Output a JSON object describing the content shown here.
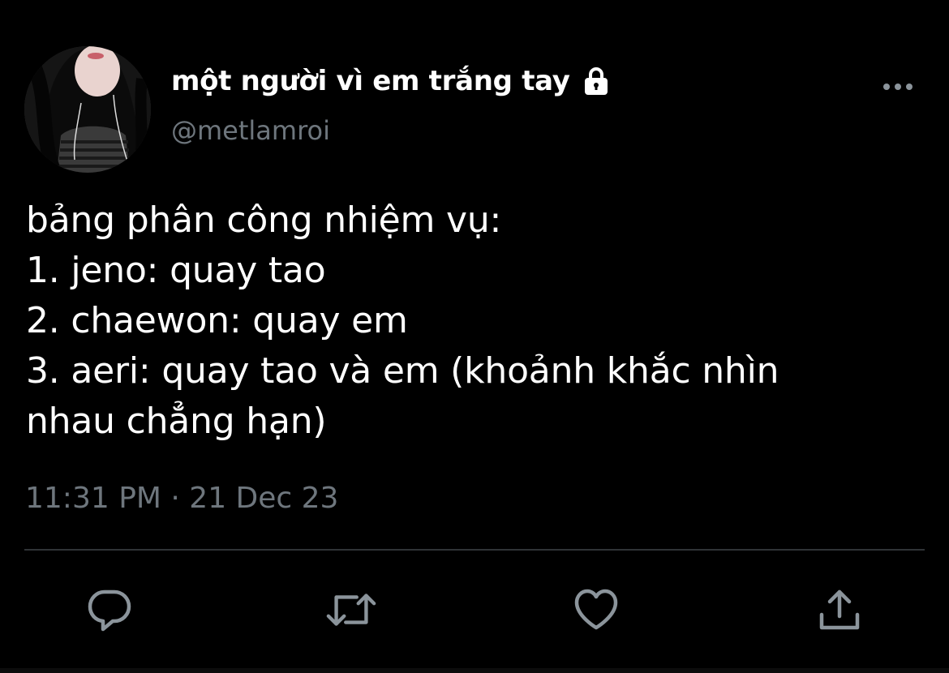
{
  "user": {
    "display_name": "một người vì em trắng tay",
    "handle": "@metlamroi",
    "protected_icon": "lock-icon"
  },
  "tweet": {
    "lines": [
      "bảng phân công nhiệm vụ:",
      "1. jeno: quay tao",
      "2. chaewon: quay em",
      "3. aeri: quay tao và em (khoảnh khắc nhìn",
      "nhau chẳng hạn)"
    ],
    "timestamp": "11:31 PM · 21 Dec 23"
  },
  "actions": [
    "reply-icon",
    "retweet-icon",
    "like-icon",
    "share-icon"
  ],
  "colors": {
    "background": "#000000",
    "text": "#ffffff",
    "muted": "#6e767d",
    "divider": "#2f3336"
  }
}
